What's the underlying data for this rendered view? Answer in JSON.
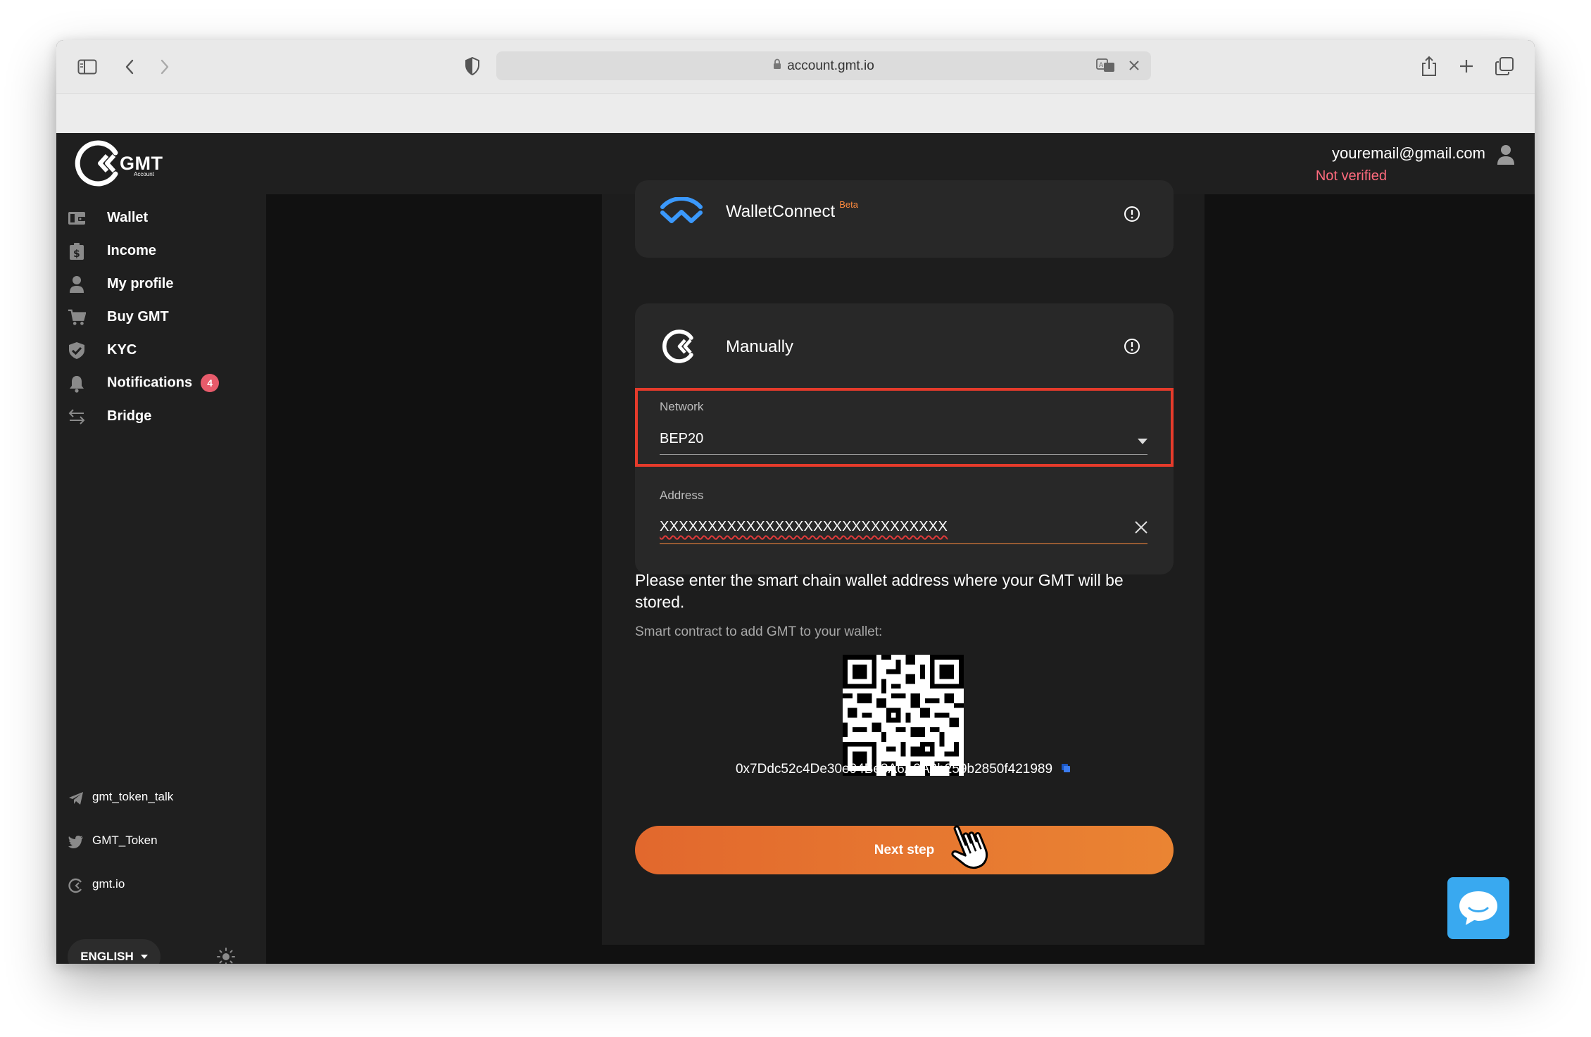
{
  "browser": {
    "url": "account.gmt.io"
  },
  "header": {
    "logo_text": "GMT",
    "logo_sub": "Account",
    "user_email": "youremail@gmail.com",
    "user_status": "Not verified",
    "status_color": "#ff6b7e"
  },
  "sidebar": {
    "items": [
      {
        "label": "Wallet",
        "icon": "wallet-icon"
      },
      {
        "label": "Income",
        "icon": "income-icon"
      },
      {
        "label": "My profile",
        "icon": "user-icon"
      },
      {
        "label": "Buy GMT",
        "icon": "cart-icon"
      },
      {
        "label": "KYC",
        "icon": "shield-check-icon"
      },
      {
        "label": "Notifications",
        "icon": "bell-icon",
        "badge": "4"
      },
      {
        "label": "Bridge",
        "icon": "bridge-arrows-icon"
      }
    ],
    "social": [
      {
        "label": "gmt_token_talk",
        "icon": "telegram-icon"
      },
      {
        "label": "GMT_Token",
        "icon": "twitter-icon"
      },
      {
        "label": "gmt.io",
        "icon": "gmt-logo-icon"
      }
    ],
    "language": "ENGLISH"
  },
  "main": {
    "walletconnect": {
      "title": "WalletConnect",
      "badge": "Beta"
    },
    "manual": {
      "title": "Manually",
      "network_label": "Network",
      "network_value": "BEP20",
      "address_label": "Address",
      "address_value": "XXXXXXXXXXXXXXXXXXXXXXXXXXXXXX"
    },
    "instruction": "Please enter the smart chain wallet address where your GMT will be stored.",
    "contract_label": "Smart contract to add GMT to your wallet:",
    "contract_address": "0x7Ddc52c4De30e94Be3A6A0A2b259b2850f421989",
    "next_button": "Next step",
    "accent_color": "#e2682d"
  }
}
